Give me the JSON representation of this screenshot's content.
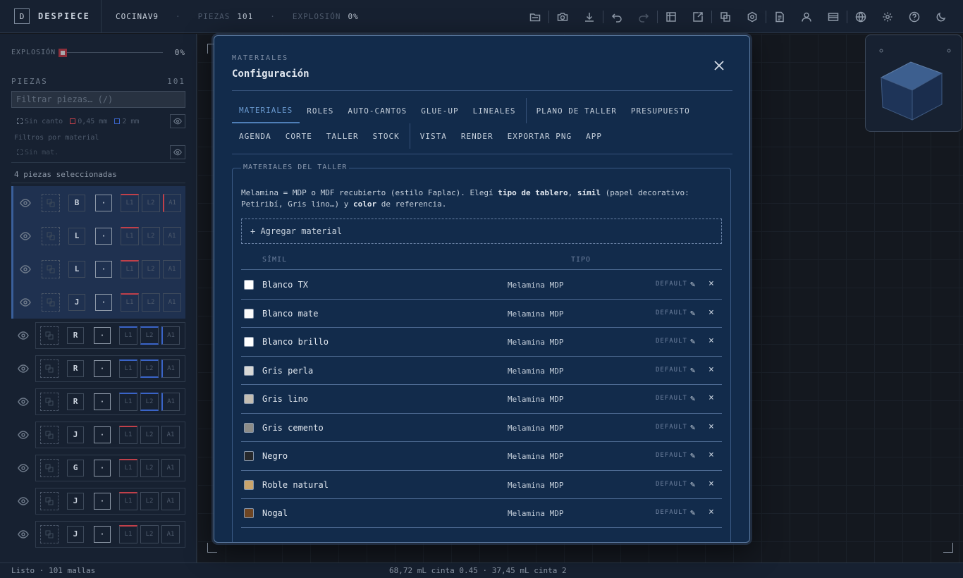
{
  "app": {
    "logo": "D",
    "name": "DESPIECE"
  },
  "header": {
    "project": "COCINAV9",
    "sep": "·",
    "piezas_label": "PIEZAS",
    "piezas_value": "101",
    "explosion_label": "EXPLOSIÓN",
    "explosion_value": "0%"
  },
  "toolbar": {
    "icons": [
      "folder-icon",
      "camera-icon",
      "download-icon",
      "undo-icon",
      "redo-icon",
      "layout-icon",
      "export-icon",
      "copy-icon",
      "settings-hex-icon",
      "document-icon",
      "user-icon",
      "card-icon",
      "globe-icon",
      "gear-icon",
      "help-icon",
      "moon-icon"
    ]
  },
  "sidebar": {
    "explosion_label": "EXPLOSIÓN",
    "explosion_value": "0%",
    "explosion_fraction": 0,
    "piezas_label": "PIEZAS",
    "piezas_count": "101",
    "filter_placeholder": "Filtrar piezas… (/)",
    "legend": {
      "sin_canto": "Sin canto",
      "c045": "0,45 mm",
      "c2": "2 mm"
    },
    "filtros_material": "Filtros por material",
    "sin_mat": "Sin mat.",
    "selected_text": "4 piezas seleccionadas",
    "pieces": [
      {
        "letter": "B",
        "dot": "·",
        "e1": "L1",
        "e2": "L2",
        "e3": "A1"
      },
      {
        "letter": "L",
        "dot": "·",
        "e1": "L1",
        "e2": "L2",
        "e3": "A1"
      },
      {
        "letter": "L",
        "dot": "·",
        "e1": "L1",
        "e2": "L2",
        "e3": "A1"
      },
      {
        "letter": "J",
        "dot": "·",
        "e1": "L1",
        "e2": "L2",
        "e3": "A1"
      },
      {
        "letter": "R",
        "dot": "·",
        "e1": "L1",
        "e2": "L2",
        "e3": "A1"
      },
      {
        "letter": "R",
        "dot": "·",
        "e1": "L1",
        "e2": "L2",
        "e3": "A1"
      },
      {
        "letter": "R",
        "dot": "·",
        "e1": "L1",
        "e2": "L2",
        "e3": "A1"
      },
      {
        "letter": "J",
        "dot": "·",
        "e1": "L1",
        "e2": "L2",
        "e3": "A1"
      },
      {
        "letter": "G",
        "dot": "·",
        "e1": "L1",
        "e2": "L2",
        "e3": "A1"
      },
      {
        "letter": "J",
        "dot": "·",
        "e1": "L1",
        "e2": "L2",
        "e3": "A1"
      },
      {
        "letter": "J",
        "dot": "·",
        "e1": "L1",
        "e2": "L2",
        "e3": "A1"
      }
    ]
  },
  "status": {
    "left": "Listo · 101 mallas",
    "center": "68,72 mL cinta 0.45 · 37,45 mL cinta 2"
  },
  "modal": {
    "eyebrow": "MATERIALES",
    "title": "Configuración",
    "tabs_row1": [
      "MATERIALES",
      "ROLES",
      "AUTO-CANTOS",
      "GLUE-UP",
      "LINEALES",
      "PLANO DE TALLER",
      "PRESUPUESTO"
    ],
    "tabs_row2": [
      "AGENDA",
      "CORTE",
      "TALLER",
      "STOCK",
      "VISTA",
      "RENDER",
      "EXPORTAR PNG",
      "APP"
    ],
    "section_title": "MATERIALES DEL TALLER",
    "desc": {
      "p1": "Melamina = MDP o MDF recubierto (estilo Faplac). Elegí ",
      "b1": "tipo de tablero",
      "p2": ", ",
      "b2": "símil",
      "p3": " (papel decorativo: Petiribí, Gris lino…) y ",
      "b3": "color",
      "p4": " de referencia."
    },
    "add_button": "+ Agregar material",
    "col_simil": "SÍMIL",
    "col_tipo": "TIPO",
    "edit_glyph": "✎",
    "delete_glyph": "×",
    "materials": [
      {
        "name": "Blanco TX",
        "tipo": "Melamina MDP",
        "tag": "DEFAULT",
        "color": "#ffffff"
      },
      {
        "name": "Blanco mate",
        "tipo": "Melamina MDP",
        "tag": "DEFAULT",
        "color": "#fbfbfa"
      },
      {
        "name": "Blanco brillo",
        "tipo": "Melamina MDP",
        "tag": "DEFAULT",
        "color": "#ffffff"
      },
      {
        "name": "Gris perla",
        "tipo": "Melamina MDP",
        "tag": "DEFAULT",
        "color": "#d8d8d6"
      },
      {
        "name": "Gris lino",
        "tipo": "Melamina MDP",
        "tag": "DEFAULT",
        "color": "#c3bdb2"
      },
      {
        "name": "Gris cemento",
        "tipo": "Melamina MDP",
        "tag": "DEFAULT",
        "color": "#8c8c88"
      },
      {
        "name": "Negro",
        "tipo": "Melamina MDP",
        "tag": "DEFAULT",
        "color": "#26282b"
      },
      {
        "name": "Roble natural",
        "tipo": "Melamina MDP",
        "tag": "DEFAULT",
        "color": "#c9a46c"
      },
      {
        "name": "Nogal",
        "tipo": "Melamina MDP",
        "tag": "DEFAULT",
        "color": "#6e4523"
      }
    ]
  }
}
